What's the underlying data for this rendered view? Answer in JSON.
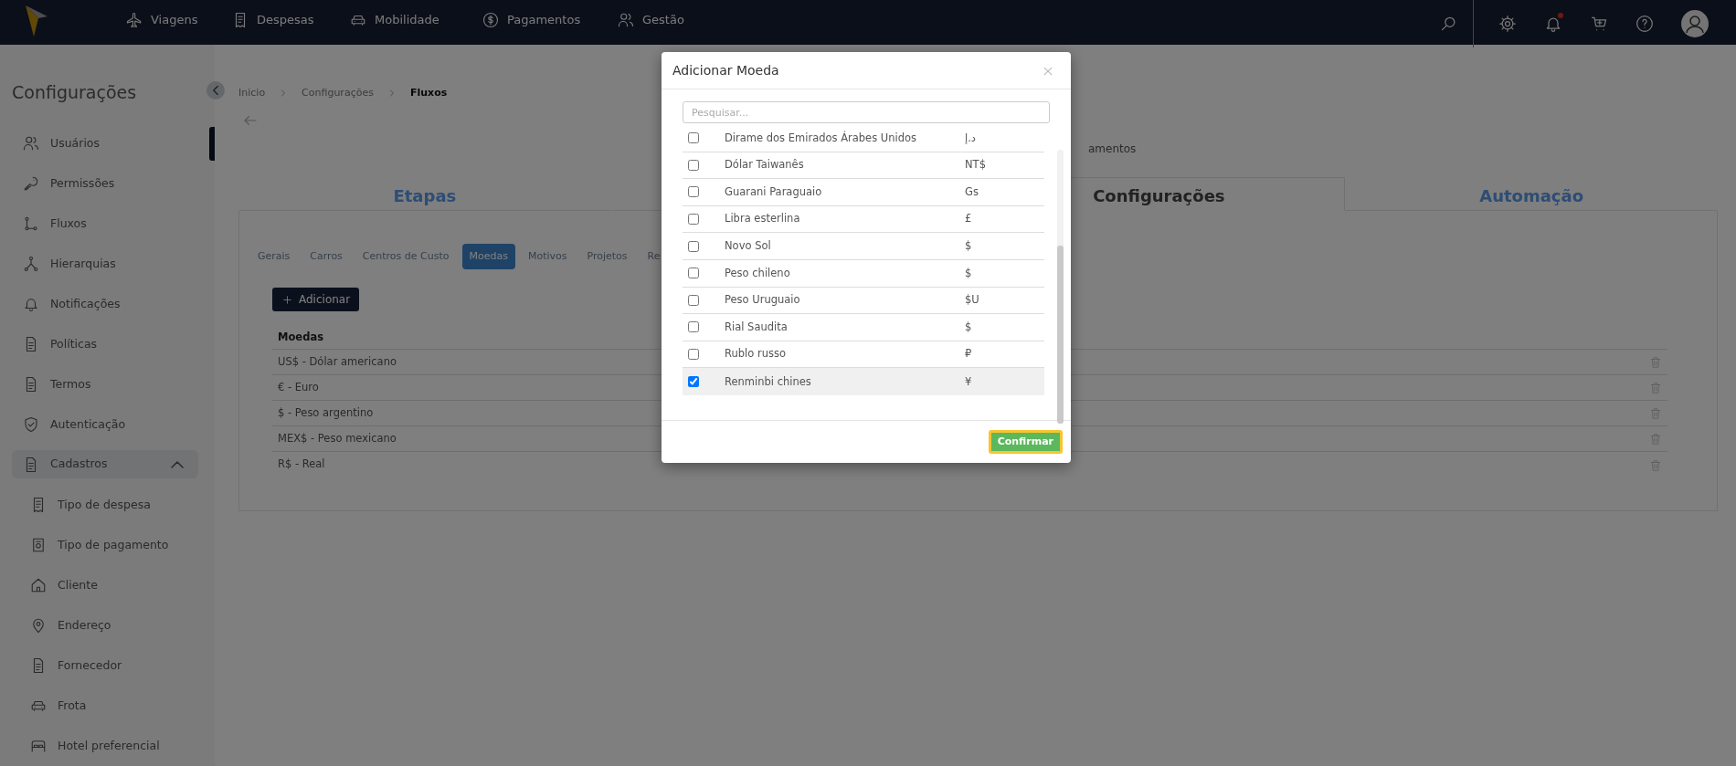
{
  "navbar": {
    "menu": [
      {
        "label": "Viagens"
      },
      {
        "label": "Despesas"
      },
      {
        "label": "Mobilidade"
      },
      {
        "label": "Pagamentos"
      },
      {
        "label": "Gestão"
      }
    ],
    "notification_dot": true
  },
  "sidebar": {
    "title": "Configurações",
    "items": [
      {
        "label": "Usuários"
      },
      {
        "label": "Permissões"
      },
      {
        "label": "Fluxos"
      },
      {
        "label": "Hierarquias"
      },
      {
        "label": "Notificações"
      },
      {
        "label": "Políticas"
      },
      {
        "label": "Termos"
      },
      {
        "label": "Autenticação"
      },
      {
        "label": "Cadastros",
        "expanded": true,
        "children": [
          {
            "label": "Tipo de despesa"
          },
          {
            "label": "Tipo de pagamento"
          },
          {
            "label": "Cliente"
          },
          {
            "label": "Endereço"
          },
          {
            "label": "Fornecedor"
          },
          {
            "label": "Frota"
          },
          {
            "label": "Hotel preferencial"
          }
        ]
      }
    ]
  },
  "breadcrumb": [
    "Inicio",
    "Configurações",
    "Fluxos"
  ],
  "partial_text": "amentos",
  "main_tabs": [
    {
      "label": "Etapas",
      "selected": false
    },
    {
      "label": "Configurações",
      "selected": true
    },
    {
      "label": "Automação",
      "selected": false
    }
  ],
  "sub_tabs": [
    {
      "label": "Gerais",
      "selected": false
    },
    {
      "label": "Carros",
      "selected": false
    },
    {
      "label": "Centros de Custo",
      "selected": false
    },
    {
      "label": "Moedas",
      "selected": true
    },
    {
      "label": "Motivos",
      "selected": false
    },
    {
      "label": "Projetos",
      "selected": false
    },
    {
      "label": "Re",
      "selected": false
    }
  ],
  "add_button": "Adicionar",
  "table": {
    "columns": [
      "Moedas"
    ],
    "rows": [
      "US$ - Dólar americano",
      "€ - Euro",
      "$ - Peso argentino",
      "MEX$ - Peso mexicano",
      "R$ - Real"
    ]
  },
  "modal": {
    "title": "Adicionar Moeda",
    "search": {
      "placeholder": "Pesquisar..."
    },
    "items": [
      {
        "name": "Dirame dos Emirados Árabes Unidos",
        "symbol": "د.إ",
        "checked": false
      },
      {
        "name": "Dólar Taiwanês",
        "symbol": "NT$",
        "checked": false
      },
      {
        "name": "Guarani Paraguaio",
        "symbol": "Gs",
        "checked": false
      },
      {
        "name": "Libra esterlina",
        "symbol": "£",
        "checked": false
      },
      {
        "name": "Novo Sol",
        "symbol": "$",
        "checked": false
      },
      {
        "name": "Peso chileno",
        "symbol": "$",
        "checked": false
      },
      {
        "name": "Peso Uruguaio",
        "symbol": "$U",
        "checked": false
      },
      {
        "name": "Rial Saudita",
        "symbol": "$",
        "checked": false
      },
      {
        "name": "Rublo russo",
        "symbol": "₽",
        "checked": false
      },
      {
        "name": "Renminbi chines",
        "symbol": "¥",
        "checked": true
      }
    ],
    "confirm_button": "Confirmar"
  }
}
